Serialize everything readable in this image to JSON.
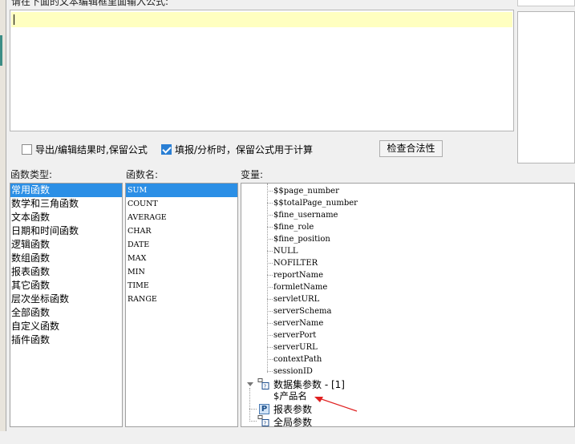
{
  "formula_editor": {
    "prompt_label": "请在下面的文本编辑框里面输入公式:",
    "formula_text": ""
  },
  "options": {
    "keep_formula_export": {
      "label": "导出/编辑结果时,保留公式",
      "checked": false
    },
    "keep_formula_fill": {
      "label": "填报/分析时，保留公式用于计算",
      "checked": true
    },
    "check_validity_label": "检查合法性"
  },
  "function_types": {
    "label": "函数类型:",
    "items": [
      "常用函数",
      "数学和三角函数",
      "文本函数",
      "日期和时间函数",
      "逻辑函数",
      "数组函数",
      "报表函数",
      "其它函数",
      "层次坐标函数",
      "全部函数",
      "自定义函数",
      "插件函数"
    ],
    "selected_index": 0
  },
  "function_names": {
    "label": "函数名:",
    "items": [
      "SUM",
      "COUNT",
      "AVERAGE",
      "CHAR",
      "DATE",
      "MAX",
      "MIN",
      "TIME",
      "RANGE"
    ],
    "selected_index": 0
  },
  "variables": {
    "label": "变量:",
    "items": [
      "$$page_number",
      "$$totalPage_number",
      "$fine_username",
      "$fine_role",
      "$fine_position",
      "NULL",
      "NOFILTER",
      "reportName",
      "formletName",
      "servletURL",
      "serverSchema",
      "serverName",
      "serverPort",
      "serverURL",
      "contextPath",
      "sessionID"
    ],
    "dataset_params": {
      "label": "数据集参数 - [1]",
      "icon": "dataset-icon",
      "children": [
        "$产品名"
      ]
    },
    "report_params": {
      "label": "报表参数",
      "icon": "P"
    },
    "global_params": {
      "label": "全局参数",
      "icon": "dataset-icon"
    }
  },
  "annotation": {
    "type": "red-arrow",
    "color": "#e02020"
  }
}
